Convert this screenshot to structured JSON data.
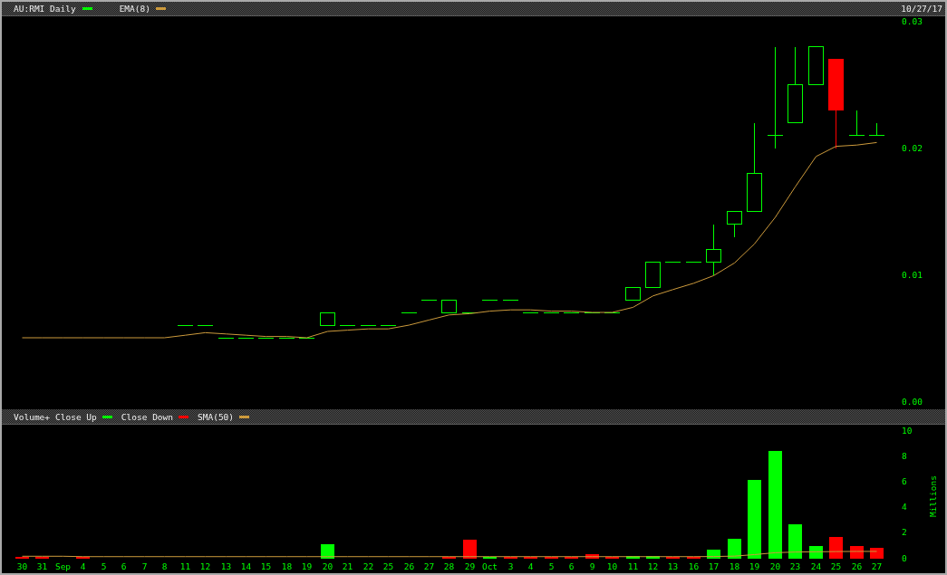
{
  "price_panel": {
    "legend": [
      {
        "label": "AU:RMI Daily",
        "color": "#00ff00"
      }
    ],
    "date": "10/27/17",
    "chart_data": {
      "type": "line",
      "ylim": [
        0,
        0.03
      ],
      "yticks": [
        {
          "value": 0,
          "label": "0.00"
        },
        {
          "value": 0.01,
          "label": "0.01"
        },
        {
          "value": 0.02,
          "label": "0.02"
        },
        {
          "value": 0.03,
          "label": "0.03"
        }
      ],
      "series": [
        {
          "name": "EMA(8)",
          "color": "#cc9a3c",
          "values": [
            0.005,
            0.005,
            0.005,
            0.005,
            0.005,
            0.005,
            0.005,
            0.005,
            0.0052,
            0.0054,
            0.0053,
            0.0052,
            0.0051,
            0.0051,
            0.005,
            0.0055,
            0.0056,
            0.0057,
            0.0057,
            0.006,
            0.0064,
            0.0068,
            0.0069,
            0.0071,
            0.0072,
            0.0072,
            0.0071,
            0.0071,
            0.007,
            0.007,
            0.0074,
            0.0083,
            0.0088,
            0.0093,
            0.0099,
            0.0109,
            0.0124,
            0.0145,
            0.0169,
            0.0193,
            0.0201,
            0.0202,
            0.0204
          ]
        }
      ]
    }
  },
  "volume_panel": {
    "chart_data": {
      "type": "bar",
      "title": "Volume+",
      "ylabel": "Millions",
      "ylim": [
        0,
        10
      ],
      "yticks": [
        0,
        2,
        4,
        6,
        8,
        10
      ],
      "categories": [
        "30",
        "31",
        "Sep",
        "4",
        "5",
        "6",
        "7",
        "8",
        "11",
        "12",
        "13",
        "14",
        "15",
        "18",
        "19",
        "20",
        "21",
        "22",
        "25",
        "26",
        "27",
        "28",
        "29",
        "Oct",
        "3",
        "4",
        "5",
        "6",
        "9",
        "10",
        "11",
        "12",
        "13",
        "16",
        "17",
        "18",
        "19",
        "20",
        "23",
        "24",
        "25",
        "26",
        "27"
      ],
      "series": [
        {
          "name": "Close Up",
          "color": "#00ff00",
          "values": [
            null,
            null,
            null,
            null,
            null,
            null,
            null,
            null,
            null,
            null,
            null,
            null,
            null,
            null,
            null,
            1.07,
            null,
            null,
            null,
            null,
            null,
            null,
            null,
            0.05,
            null,
            null,
            null,
            null,
            null,
            null,
            0.15,
            0.15,
            null,
            null,
            0.62,
            1.5,
            6.1,
            8.4,
            2.6,
            0.95,
            null,
            null,
            null
          ]
        },
        {
          "name": "Close Down",
          "color": "#ff0000",
          "values": [
            0.08,
            0.08,
            null,
            0.08,
            null,
            null,
            null,
            null,
            null,
            null,
            null,
            null,
            null,
            null,
            null,
            null,
            null,
            null,
            null,
            null,
            null,
            0.08,
            1.45,
            null,
            0.05,
            0.05,
            0.05,
            0.05,
            0.3,
            0.05,
            null,
            null,
            0.05,
            0.05,
            null,
            null,
            null,
            null,
            null,
            null,
            1.6,
            0.95,
            0.75
          ]
        },
        {
          "name": "SMA(50)",
          "type": "line",
          "color": "#cc9a3c",
          "values": [
            0.12,
            0.12,
            0.12,
            0.09,
            0.09,
            0.09,
            0.09,
            0.09,
            0.09,
            0.09,
            0.09,
            0.09,
            0.09,
            0.09,
            0.09,
            0.09,
            0.09,
            0.09,
            0.09,
            0.09,
            0.09,
            0.09,
            0.09,
            0.09,
            0.09,
            0.09,
            0.09,
            0.09,
            0.09,
            0.09,
            0.09,
            0.09,
            0.09,
            0.09,
            0.1,
            0.13,
            0.25,
            0.4,
            0.45,
            0.47,
            0.49,
            0.5,
            0.5
          ]
        }
      ]
    }
  }
}
